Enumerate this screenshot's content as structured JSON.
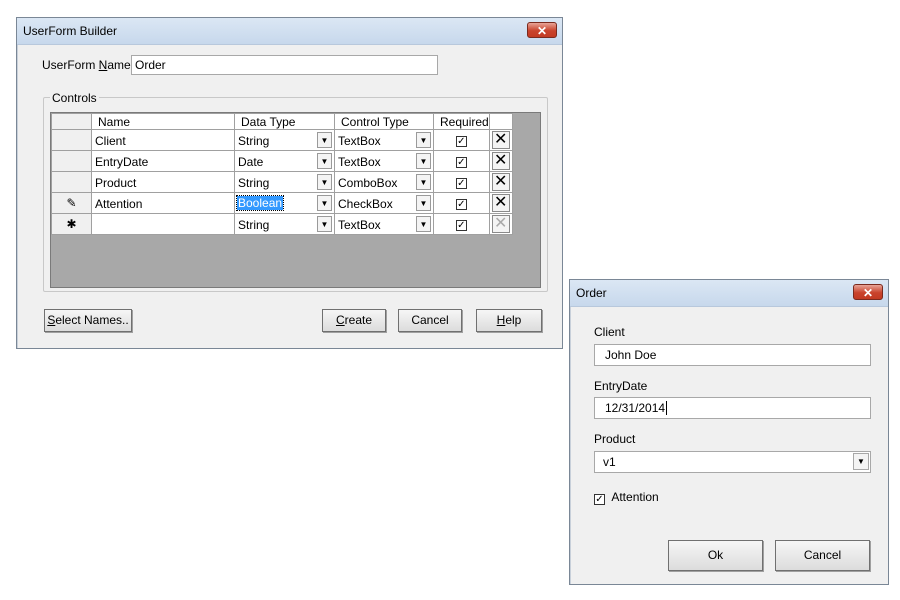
{
  "builder": {
    "title": "UserForm Builder",
    "close_glyph": "✕",
    "form_name_label_pre": "UserForm ",
    "form_name_label_u": "N",
    "form_name_label_post": "ame:",
    "form_name_value": "Order",
    "controls_group_label": "Controls",
    "columns": [
      "Name",
      "Data Type",
      "Control Type",
      "Required"
    ],
    "rows": [
      {
        "indicator": "",
        "name": "Client",
        "data_type": "String",
        "control_type": "TextBox",
        "required": true,
        "delete_enabled": true,
        "editing": false
      },
      {
        "indicator": "",
        "name": "EntryDate",
        "data_type": "Date",
        "control_type": "TextBox",
        "required": true,
        "delete_enabled": true,
        "editing": false
      },
      {
        "indicator": "",
        "name": "Product",
        "data_type": "String",
        "control_type": "ComboBox",
        "required": true,
        "delete_enabled": true,
        "editing": false
      },
      {
        "indicator": "✎",
        "name": "Attention",
        "data_type": "Boolean",
        "control_type": "CheckBox",
        "required": true,
        "delete_enabled": true,
        "editing": true
      },
      {
        "indicator": "✱",
        "name": "",
        "data_type": "String",
        "control_type": "TextBox",
        "required": true,
        "delete_enabled": false,
        "editing": false
      }
    ],
    "buttons": {
      "select_names_u": "S",
      "select_names_rest": "elect Names..",
      "create_u": "C",
      "create_rest": "reate",
      "cancel": "Cancel",
      "help_u": "H",
      "help_rest": "elp"
    },
    "icons": {
      "dropdown": "dropdown-arrow-icon",
      "delete": "delete-row-icon",
      "edit": "pencil-icon",
      "new_row": "new-row-asterisk-icon",
      "checkbox": "checkbox-checked-icon"
    }
  },
  "order": {
    "title": "Order",
    "close_glyph": "✕",
    "client_label": "Client",
    "client_value": "John Doe",
    "entrydate_label": "EntryDate",
    "entrydate_value": "12/31/2014",
    "product_label": "Product",
    "product_value": "v1",
    "attention_label": "Attention",
    "attention_checked": true,
    "ok_label": "Ok",
    "cancel_label": "Cancel"
  },
  "colors": {
    "titlebar": "#c7d8ec",
    "close_button": "#c9432c",
    "selection": "#3399ff",
    "grid_background": "#a8a8a8"
  }
}
